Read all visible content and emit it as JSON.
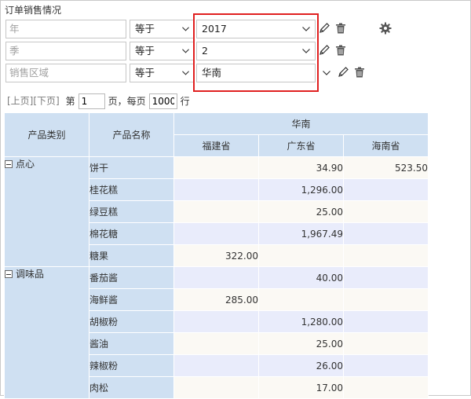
{
  "title": "订单销售情况",
  "filters": [
    {
      "field": "年",
      "op": "等于",
      "value": "2017"
    },
    {
      "field": "季",
      "op": "等于",
      "value": "2"
    },
    {
      "field": "销售区域",
      "op": "等于",
      "value": "华南"
    }
  ],
  "pager": {
    "prev": "[上页]",
    "next": "[下页]",
    "page_prefix": "第",
    "page": "1",
    "page_suffix": "页，每页",
    "per_page": "1000",
    "per_page_suffix": "行"
  },
  "table": {
    "col_category": "产品类别",
    "col_product": "产品名称",
    "region": "华南",
    "provinces": [
      "福建省",
      "广东省",
      "海南省"
    ],
    "groups": [
      {
        "category": "点心",
        "rows": [
          {
            "name": "饼干",
            "fujian": "",
            "guangdong": "34.90",
            "hainan": "523.50"
          },
          {
            "name": "桂花糕",
            "fujian": "",
            "guangdong": "1,296.00",
            "hainan": ""
          },
          {
            "name": "绿豆糕",
            "fujian": "",
            "guangdong": "25.00",
            "hainan": ""
          },
          {
            "name": "棉花糖",
            "fujian": "",
            "guangdong": "1,967.49",
            "hainan": ""
          },
          {
            "name": "糖果",
            "fujian": "322.00",
            "guangdong": "",
            "hainan": ""
          }
        ]
      },
      {
        "category": "调味品",
        "rows": [
          {
            "name": "番茄酱",
            "fujian": "",
            "guangdong": "40.00",
            "hainan": ""
          },
          {
            "name": "海鲜酱",
            "fujian": "285.00",
            "guangdong": "",
            "hainan": ""
          },
          {
            "name": "胡椒粉",
            "fujian": "",
            "guangdong": "1,280.00",
            "hainan": ""
          },
          {
            "name": "酱油",
            "fujian": "",
            "guangdong": "25.00",
            "hainan": ""
          },
          {
            "name": "辣椒粉",
            "fujian": "",
            "guangdong": "26.00",
            "hainan": ""
          },
          {
            "name": "肉松",
            "fujian": "",
            "guangdong": "17.00",
            "hainan": ""
          }
        ]
      }
    ]
  },
  "icons": [
    "edit-icon",
    "delete-icon",
    "settings-gear-icon",
    "chevron-down-icon",
    "collapse-icon"
  ]
}
